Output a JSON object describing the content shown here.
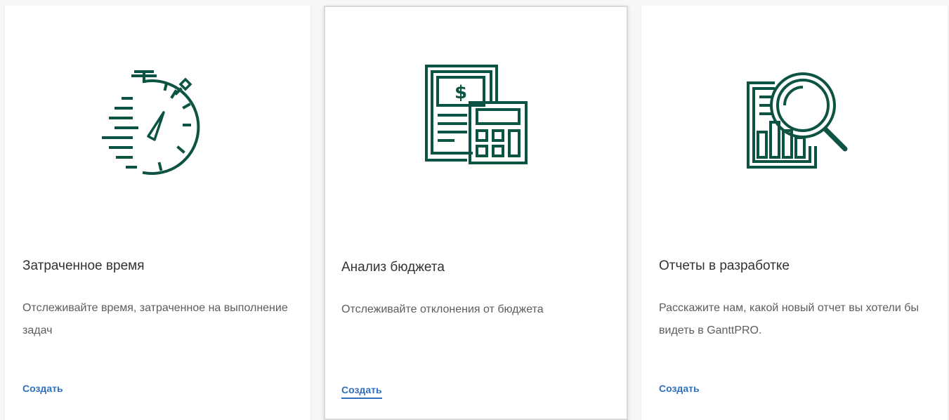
{
  "accent_color": "#0d5343",
  "link_color": "#2f6fc0",
  "cards": [
    {
      "icon": "stopwatch-icon",
      "title": "Затраченное время",
      "description": "Отслеживайте время, затраченное на выполнение задач",
      "link": "Создать"
    },
    {
      "icon": "budget-calculator-icon",
      "title": "Анализ бюджета",
      "description": "Отслеживайте отклонения от бюджета",
      "link": "Создать"
    },
    {
      "icon": "report-magnifier-icon",
      "title": "Отчеты в разработке",
      "description": "Расскажите нам, какой новый отчет вы хотели бы видеть в GanttPRO.",
      "link": "Создать"
    }
  ]
}
